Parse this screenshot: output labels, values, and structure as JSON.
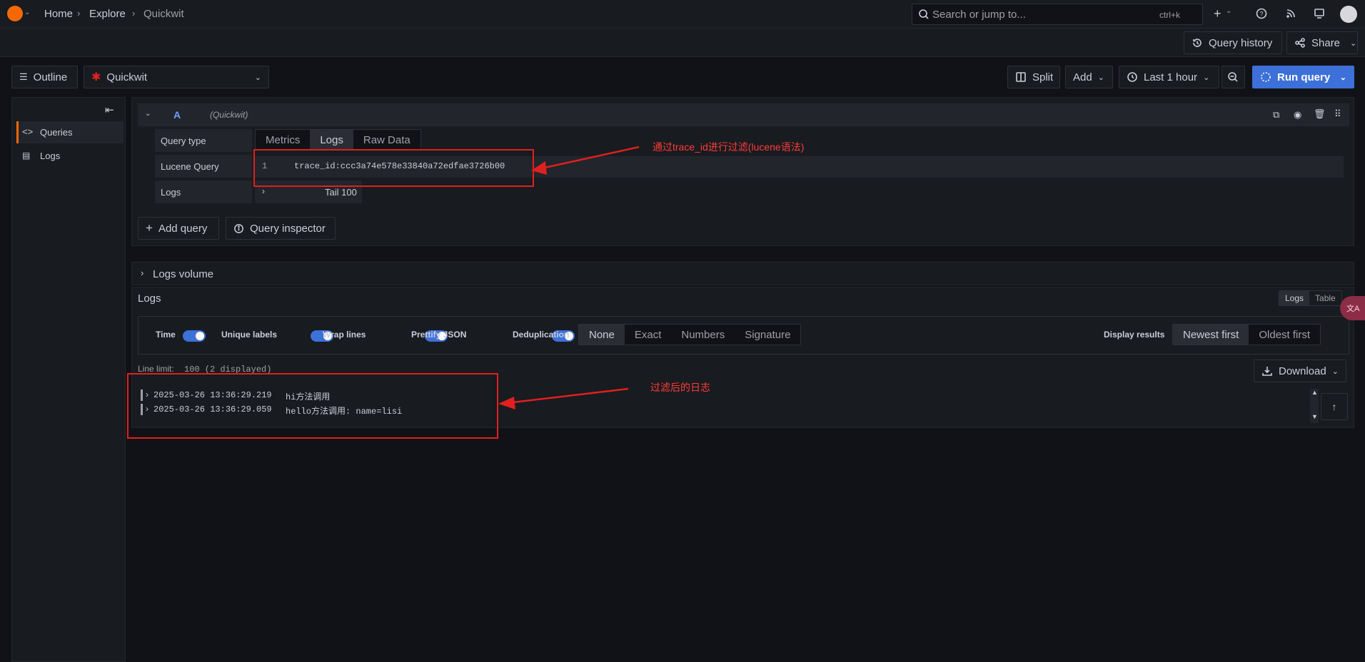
{
  "breadcrumb": {
    "home": "Home",
    "explore": "Explore",
    "current": "Quickwit"
  },
  "search": {
    "placeholder": "Search or jump to...",
    "shortcut": "ctrl+k"
  },
  "toolbar": {
    "query_history": "Query history",
    "share": "Share"
  },
  "explore_bar": {
    "outline": "Outline",
    "datasource": "Quickwit",
    "split": "Split",
    "add": "Add",
    "time_range": "Last 1 hour",
    "run_query": "Run query"
  },
  "sidebar": {
    "items": [
      {
        "label": "Queries"
      },
      {
        "label": "Logs"
      }
    ]
  },
  "query_row": {
    "ref_id": "A",
    "datasource_hint": "(Quickwit)",
    "query_type_label": "Query type",
    "query_types": [
      "Metrics",
      "Logs",
      "Raw Data"
    ],
    "selected_query_type": "Logs",
    "lucene_label": "Lucene Query",
    "line_number": "1",
    "lucene_value": "trace_id:ccc3a74e578e33840a72edfae3726b00",
    "logs_label": "Logs",
    "logs_option": "Tail 100"
  },
  "query_actions": {
    "add_query": "Add query",
    "query_inspector": "Query inspector"
  },
  "logs_volume": {
    "title": "Logs volume"
  },
  "logs_panel": {
    "title": "Logs",
    "view_modes": [
      "Logs",
      "Table"
    ],
    "options": {
      "time": "Time",
      "unique_labels": "Unique labels",
      "wrap_lines": "Wrap lines",
      "prettify_json": "Prettify JSON",
      "deduplication": "Deduplication"
    },
    "dedup_modes": [
      "None",
      "Exact",
      "Numbers",
      "Signature"
    ],
    "display_results_label": "Display results",
    "order_modes": [
      "Newest first",
      "Oldest first"
    ],
    "line_limit_label": "Line limit:",
    "line_limit_value": "100 (2 displayed)",
    "download": "Download",
    "rows": [
      {
        "timestamp": "2025-03-26 13:36:29.219",
        "message": "hi方法调用"
      },
      {
        "timestamp": "2025-03-26 13:36:29.059",
        "message": "hello方法调用: name=lisi"
      }
    ]
  },
  "annotations": {
    "query_note": "通过trace_id进行过滤(lucene语法)",
    "logs_note": "过滤后的日志"
  },
  "colors": {
    "accent": "#3d71d9",
    "annotation": "#e02020",
    "background": "#111217",
    "panel": "#181b1f"
  }
}
